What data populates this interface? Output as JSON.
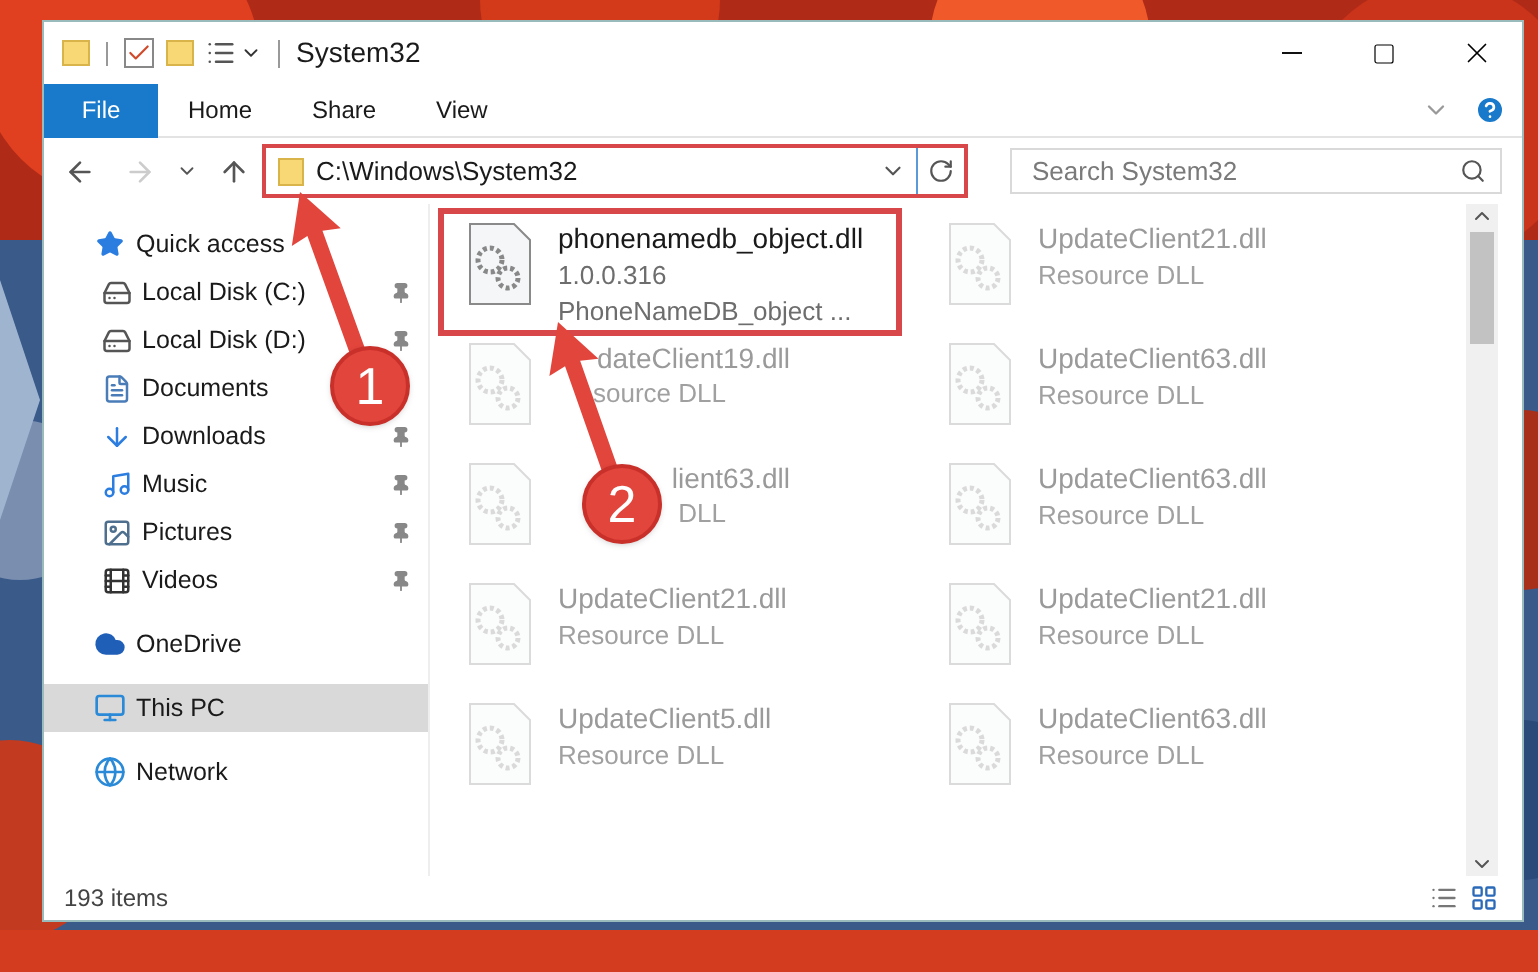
{
  "window": {
    "title": "System32"
  },
  "ribbon_tabs": [
    {
      "label": "File",
      "selected": true
    },
    {
      "label": "Home",
      "selected": false
    },
    {
      "label": "Share",
      "selected": false
    },
    {
      "label": "View",
      "selected": false
    }
  ],
  "address_bar": {
    "value": "C:\\Windows\\System32",
    "highlighted": true
  },
  "search": {
    "placeholder": "Search System32"
  },
  "sidebar": {
    "items": [
      {
        "label": "Quick access",
        "kind": "quick",
        "pinned": false,
        "selected": false,
        "children": [
          {
            "label": "Local Disk (C:)",
            "kind": "diskc",
            "pinned": true,
            "selected": false
          },
          {
            "label": "Local Disk (D:)",
            "kind": "disk",
            "pinned": true,
            "selected": false
          },
          {
            "label": "Documents",
            "kind": "documents",
            "selected": false
          },
          {
            "label": "Downloads",
            "kind": "downloads",
            "pinned": true,
            "selected": false
          },
          {
            "label": "Music",
            "kind": "music",
            "pinned": true,
            "selected": false
          },
          {
            "label": "Pictures",
            "kind": "pictures",
            "pinned": true,
            "selected": false
          },
          {
            "label": "Videos",
            "kind": "videos",
            "pinned": true,
            "selected": false
          }
        ]
      },
      {
        "label": "OneDrive",
        "kind": "cloud",
        "pinned": false,
        "selected": false
      },
      {
        "label": "This PC",
        "kind": "pc",
        "pinned": false,
        "selected": true
      },
      {
        "label": "Network",
        "kind": "network",
        "pinned": false,
        "selected": false
      }
    ]
  },
  "files": [
    {
      "name": "phonenamedb_object.dll",
      "details": [
        "1.0.0.316",
        "PhoneNameDB_object ..."
      ],
      "faded": false,
      "highlighted": true
    },
    {
      "name": "UpdateClient21.dll",
      "details": [
        "Resource DLL"
      ],
      "faded": true,
      "highlighted": false
    },
    {
      "name": "dateClient19.dll",
      "details": [
        "source DLL"
      ],
      "faded": true,
      "highlighted": false,
      "covered": true
    },
    {
      "name": "UpdateClient63.dll",
      "details": [
        "Resource DLL"
      ],
      "faded": true,
      "highlighted": false
    },
    {
      "name": "lient63.dll",
      "details": [
        "DLL"
      ],
      "faded": true,
      "highlighted": false,
      "covered": true
    },
    {
      "name": "UpdateClient63.dll",
      "details": [
        "Resource DLL"
      ],
      "faded": true,
      "highlighted": false
    },
    {
      "name": "UpdateClient21.dll",
      "details": [
        "Resource DLL"
      ],
      "faded": true,
      "highlighted": false
    },
    {
      "name": "UpdateClient21.dll",
      "details": [
        "Resource DLL"
      ],
      "faded": true,
      "highlighted": false
    },
    {
      "name": "UpdateClient5.dll",
      "details": [
        "Resource DLL"
      ],
      "faded": true,
      "highlighted": false
    },
    {
      "name": "UpdateClient63.dll",
      "details": [
        "Resource DLL"
      ],
      "faded": true,
      "highlighted": false
    }
  ],
  "status_bar": {
    "count": "193 items"
  },
  "annotations": [
    {
      "label": "1"
    },
    {
      "label": "2"
    }
  ]
}
